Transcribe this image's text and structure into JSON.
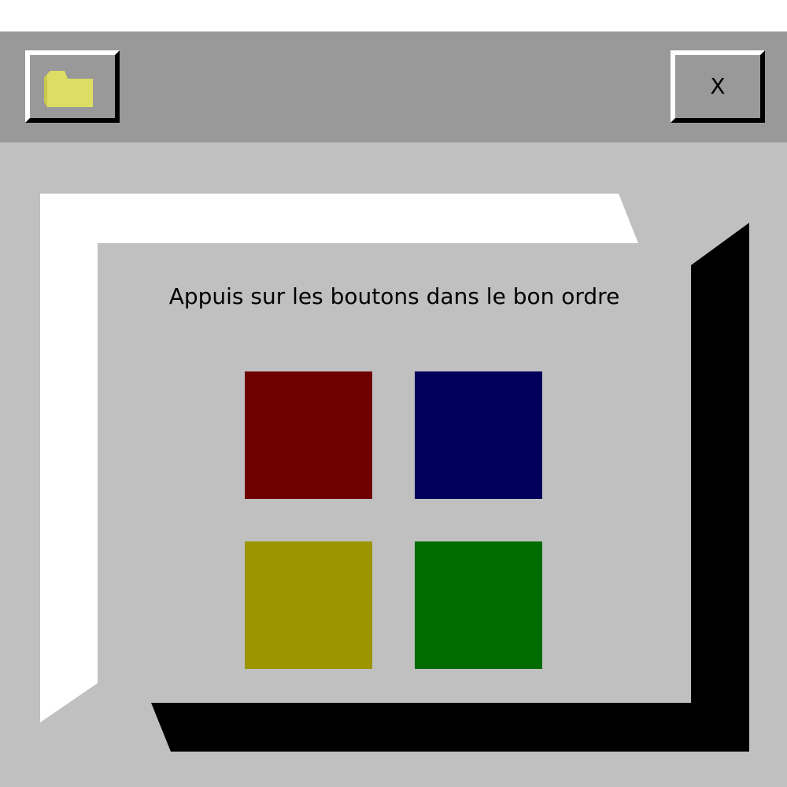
{
  "window": {
    "close_label": "X"
  },
  "dialog": {
    "instruction": "Appuis sur les boutons dans le bon ordre"
  },
  "buttons": [
    {
      "name": "red-button",
      "color": "#6e0000"
    },
    {
      "name": "blue-button",
      "color": "#00005a"
    },
    {
      "name": "yellow-button",
      "color": "#9c9500"
    },
    {
      "name": "green-button",
      "color": "#006b00"
    }
  ],
  "colors": {
    "titlebar": "#999999",
    "body": "#c0c0c0",
    "folder": "#dddd66"
  }
}
